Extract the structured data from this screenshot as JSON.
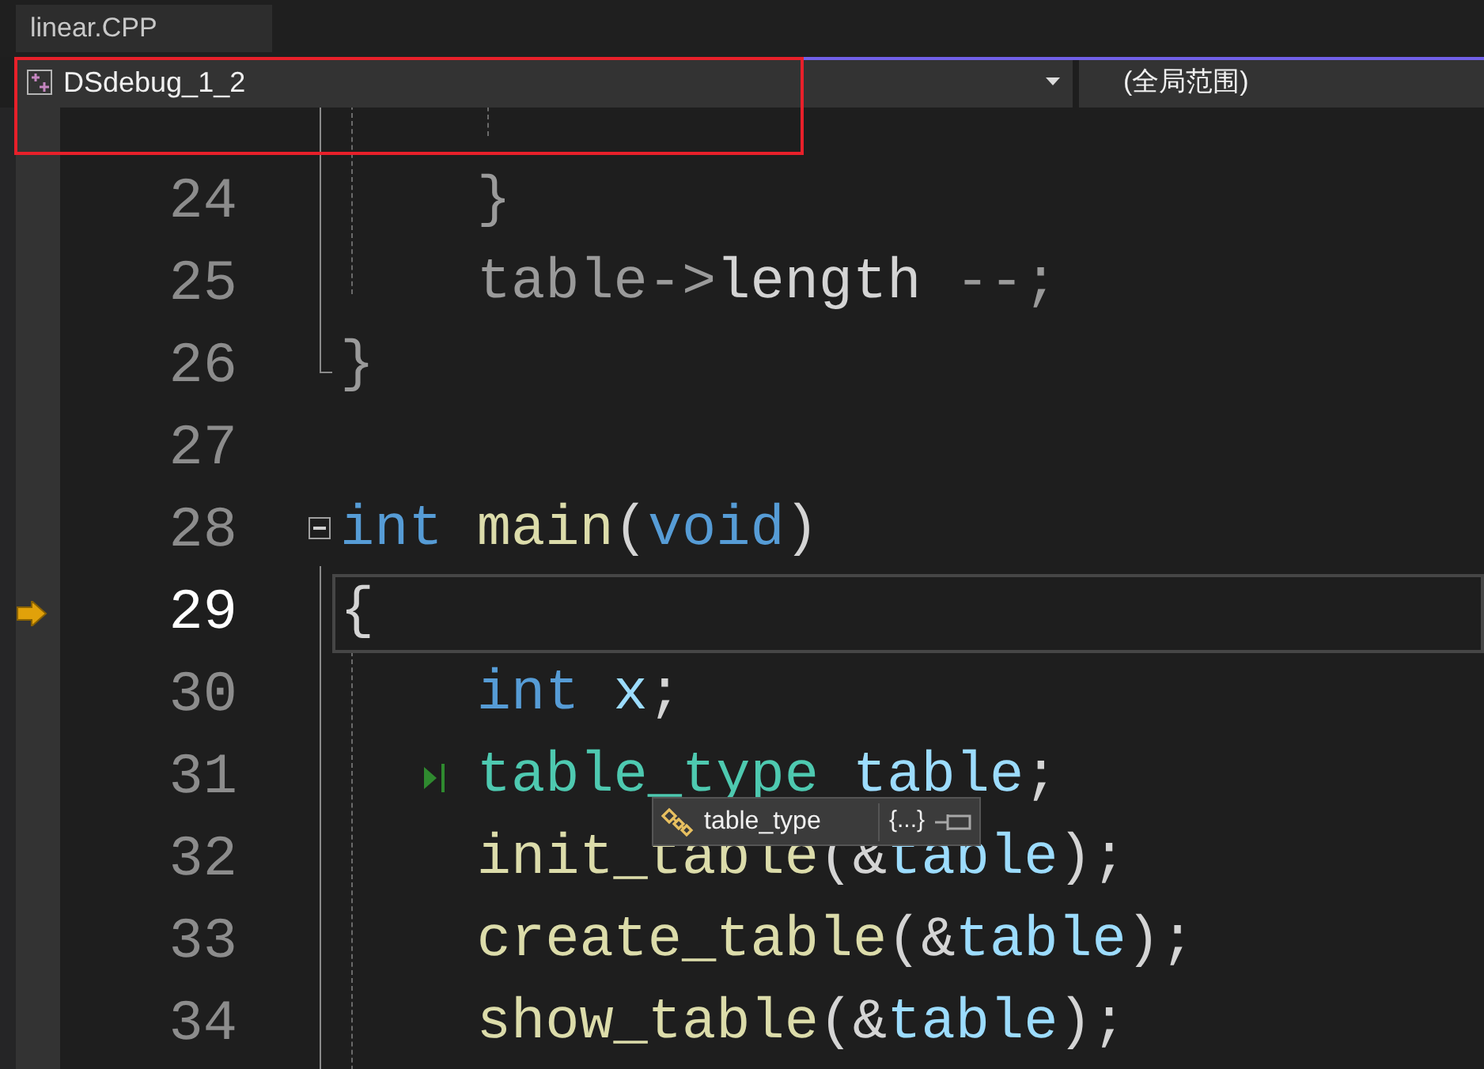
{
  "tabs": [
    {
      "label": "linear.CPP",
      "selected": true
    }
  ],
  "navigation_bar": {
    "project": "DSdebug_1_2",
    "scope": "(全局范围)",
    "highlighted": true
  },
  "lines": [
    {
      "number": "24",
      "current": false,
      "kind": "code",
      "tokens": [
        {
          "text": "    }",
          "kind": "dim"
        }
      ]
    },
    {
      "number": "25",
      "current": false,
      "kind": "code",
      "tokens": [
        {
          "text": "    table->",
          "kind": "dim"
        },
        {
          "text": "length",
          "kind": "plain"
        },
        {
          "text": " --;",
          "kind": "dim"
        }
      ]
    },
    {
      "number": "26",
      "current": false,
      "kind": "code",
      "tokens": [
        {
          "text": "}",
          "kind": "dim"
        }
      ]
    },
    {
      "number": "27",
      "current": false,
      "kind": "code"
    },
    {
      "number": "28",
      "current": false,
      "kind": "fold",
      "tokens": [
        {
          "text": "int",
          "kind": "keyword"
        },
        {
          "text": " main",
          "kind": "function"
        },
        {
          "text": "(",
          "kind": "plain"
        },
        {
          "text": "void",
          "kind": "keyword"
        },
        {
          "text": ")",
          "kind": "plain"
        }
      ]
    },
    {
      "number": "29",
      "current": true,
      "kind": "execution",
      "tokens": [
        {
          "text": "{",
          "kind": "plain"
        }
      ]
    },
    {
      "number": "30",
      "current": false,
      "kind": "code",
      "tokens": [
        {
          "text": "    int",
          "kind": "keyword"
        },
        {
          "text": " x",
          "kind": "variable"
        },
        {
          "text": ";",
          "kind": "plain"
        }
      ]
    },
    {
      "number": "31",
      "current": false,
      "kind": "run",
      "tokens": [
        {
          "text": "    table_type",
          "kind": "type"
        },
        {
          "text": " table",
          "kind": "variable"
        },
        {
          "text": ";",
          "kind": "plain"
        }
      ]
    },
    {
      "number": "32",
      "current": false,
      "kind": "code",
      "tokens": [
        {
          "text": "    init_table",
          "kind": "function"
        },
        {
          "text": "(&",
          "kind": "plain"
        },
        {
          "text": "table",
          "kind": "variable"
        },
        {
          "text": ");",
          "kind": "plain"
        }
      ]
    },
    {
      "number": "33",
      "current": false,
      "kind": "code",
      "tokens": [
        {
          "text": "    create_table",
          "kind": "function"
        },
        {
          "text": "(&",
          "kind": "plain"
        },
        {
          "text": "table",
          "kind": "variable"
        },
        {
          "text": ");",
          "kind": "plain"
        }
      ]
    },
    {
      "number": "34",
      "current": false,
      "kind": "code",
      "tokens": [
        {
          "text": "    show_table",
          "kind": "function"
        },
        {
          "text": "(&",
          "kind": "plain"
        },
        {
          "text": "table",
          "kind": "variable"
        },
        {
          "text": ");",
          "kind": "plain"
        }
      ]
    }
  ],
  "tooltip": {
    "type_name": "table_type",
    "value": "{...}"
  }
}
